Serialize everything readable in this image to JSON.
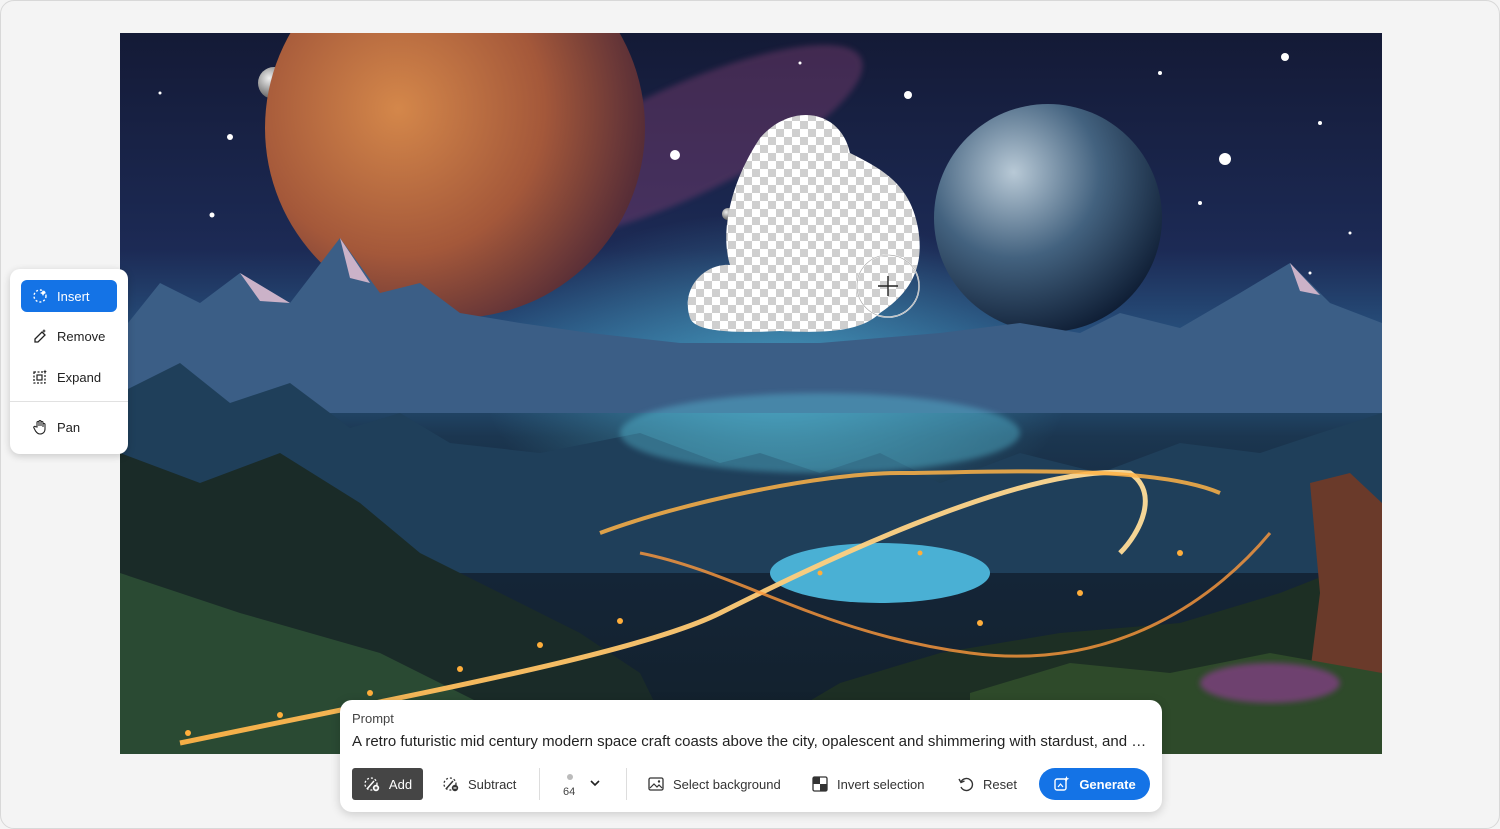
{
  "tools": {
    "items": [
      {
        "label": "Insert",
        "icon": "insert-icon",
        "active": true
      },
      {
        "label": "Remove",
        "icon": "remove-icon",
        "active": false
      },
      {
        "label": "Expand",
        "icon": "expand-icon",
        "active": false
      },
      {
        "label": "Pan",
        "icon": "hand-icon",
        "active": false
      }
    ]
  },
  "prompt": {
    "label": "Prompt",
    "text": "A retro futuristic mid century modern space craft coasts above the city, opalescent and shimmering with stardust, and b..."
  },
  "toolbar": {
    "add_label": "Add",
    "subtract_label": "Subtract",
    "brush_size": "64",
    "select_background_label": "Select background",
    "invert_selection_label": "Invert selection",
    "reset_label": "Reset",
    "generate_label": "Generate"
  },
  "colors": {
    "accent": "#1473e6",
    "add_active": "#454545"
  }
}
